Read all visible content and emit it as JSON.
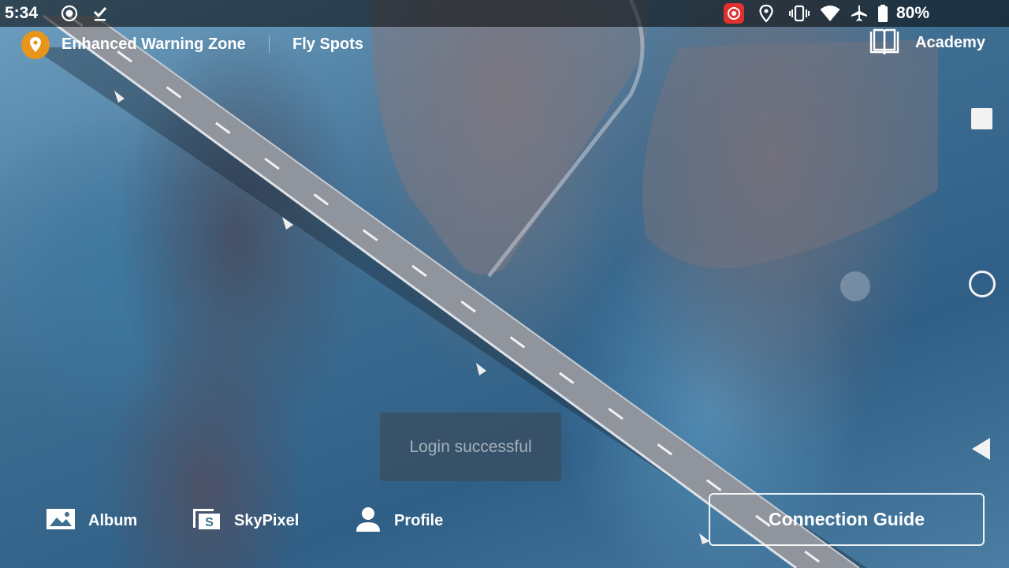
{
  "status_bar": {
    "time": "5:34",
    "battery": "80%",
    "icons": [
      "screen-record-icon",
      "download-done-icon",
      "dji-app-icon",
      "location-icon",
      "vibrate-icon",
      "wifi-icon",
      "airplane-mode-icon",
      "battery-icon"
    ]
  },
  "top_nav": {
    "zone_label": "Enhanced Warning Zone",
    "fly_spots": "Fly Spots",
    "academy": "Academy",
    "zone_pin_color": "#e8951c"
  },
  "toast": {
    "message": "Login successful"
  },
  "bottom_nav": {
    "album": "Album",
    "skypixel": "SkyPixel",
    "profile": "Profile",
    "connection_guide": "Connection Guide"
  },
  "system_nav": [
    "recents-button",
    "home-button",
    "back-button"
  ],
  "colors": {
    "accent": "#e8951c",
    "record_red": "#e0302f"
  }
}
